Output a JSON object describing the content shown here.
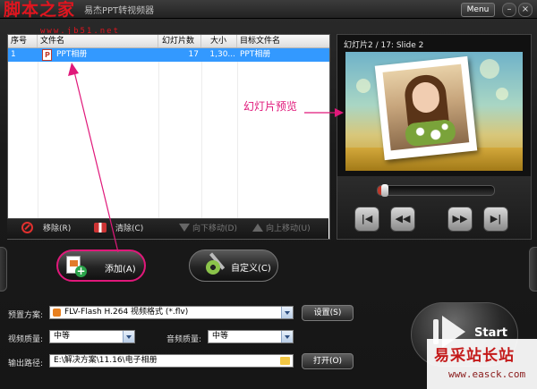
{
  "titlebar": {
    "logo_text": "脚本之家",
    "logo_url": "www.jb51.net",
    "title": "易杰PPT转视频器",
    "menu_label": "Menu",
    "minimize": "–",
    "close": "×"
  },
  "list": {
    "columns": [
      "序号",
      "文件名",
      "幻灯片数",
      "大小",
      "目标文件名"
    ],
    "rows": [
      {
        "index": "1",
        "filename": "PPT相册",
        "slides": "17",
        "size": "1,30...",
        "target": "PPT相册"
      }
    ]
  },
  "list_toolbar": {
    "remove": "移除(R)",
    "clear": "清除(C)",
    "move_down": "向下移动(D)",
    "move_up": "向上移动(U)"
  },
  "preview": {
    "title": "幻灯片2 / 17: Slide 2",
    "slider_fraction": 0.06
  },
  "actions": {
    "add": "添加(A)",
    "custom": "自定义(C)"
  },
  "form": {
    "preset_label": "预置方案:",
    "preset_value": "FLV-Flash H.264 视频格式 (*.flv)",
    "settings_button": "设置(S)",
    "video_quality_label": "视频质量:",
    "video_quality_value": "中等",
    "audio_quality_label": "音频质量:",
    "audio_quality_value": "中等",
    "output_label": "输出路径:",
    "output_value": "E:\\解决方案\\11.16\\电子相册",
    "open_button": "打开(O)"
  },
  "start_button": {
    "label": "Start"
  },
  "annotation": {
    "text": "幻灯片预览",
    "color": "#e0187a"
  },
  "watermark": {
    "cn": "易采站长站",
    "url": "www.easck.com"
  },
  "colors": {
    "selection": "#3399ff",
    "annotation": "#e0187a",
    "logo": "#e0151f"
  }
}
